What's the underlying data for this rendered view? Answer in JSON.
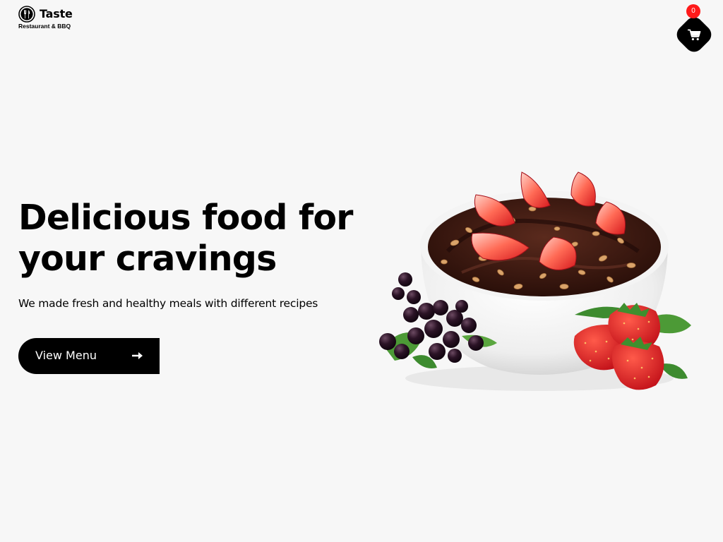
{
  "brand": {
    "name": "Taste",
    "tagline": "Restaurant & BBQ"
  },
  "cart": {
    "count": "0"
  },
  "hero": {
    "title": "Delicious food for your cravings",
    "subtitle": "We made fresh and healthy meals with different recipes",
    "button_label": "View Menu"
  },
  "icons": {
    "logo": "cutlery-logo-icon",
    "cart": "shopping-cart-icon",
    "button_arrow": "arrow-right-icon"
  },
  "colors": {
    "background": "#f7f7f7",
    "primary": "#000000",
    "badge": "#ff1a1a",
    "chocolate": "#3b1a12",
    "strawberry": "#e3242b",
    "leaf": "#3d8b2f"
  }
}
